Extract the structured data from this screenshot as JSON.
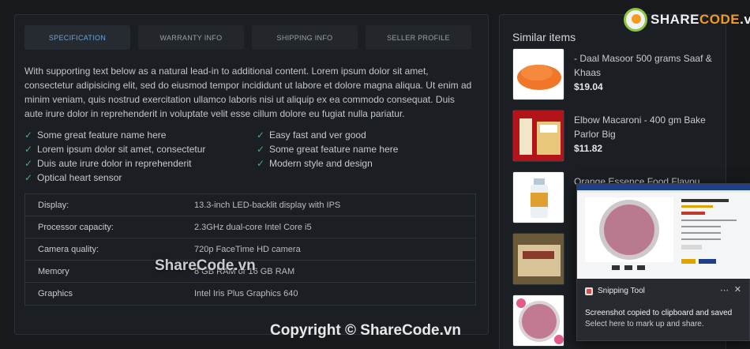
{
  "tabs": [
    {
      "label": "SPECIFICATION",
      "active": true
    },
    {
      "label": "WARRANTY INFO"
    },
    {
      "label": "SHIPPING INFO"
    },
    {
      "label": "SELLER PROFILE"
    }
  ],
  "description": "With supporting text below as a natural lead-in to additional content. Lorem ipsum dolor sit amet, consectetur adipisicing elit, sed do eiusmod tempor incididunt ut labore et dolore magna aliqua. Ut enim ad minim veniam, quis nostrud exercitation ullamco laboris nisi ut aliquip ex ea commodo consequat. Duis aute irure dolor in reprehenderit in voluptate velit esse cillum dolore eu fugiat nulla pariatur.",
  "features": [
    "Some great feature name here",
    "Easy fast and ver good",
    "Lorem ipsum dolor sit amet, consectetur",
    "Some great feature name here",
    "Duis aute irure dolor in reprehenderit",
    "Modern style and design",
    "Optical heart sensor"
  ],
  "specs": [
    {
      "key": "Display:",
      "value": "13.3-inch LED-backlit display with IPS"
    },
    {
      "key": "Processor capacity:",
      "value": "2.3GHz dual-core Intel Core i5"
    },
    {
      "key": "Camera quality:",
      "value": "720p FaceTime HD camera"
    },
    {
      "key": "Memory",
      "value": "8 GB RAM or 16 GB RAM"
    },
    {
      "key": "Graphics",
      "value": "Intel Iris Plus Graphics 640"
    }
  ],
  "similar": {
    "title": "Similar items",
    "items": [
      {
        "name": "- Daal Masoor 500 grams Saaf & Khaas",
        "price": "$19.04",
        "thumb": "lentils"
      },
      {
        "name": "Elbow Macaroni - 400 gm Bake Parlor Big",
        "price": "$11.82",
        "thumb": "macaroni"
      },
      {
        "name": "Orange Essence Food Flavou",
        "price": "",
        "thumb": "bottle"
      },
      {
        "name": "",
        "price": "",
        "thumb": "package"
      },
      {
        "name": "",
        "price": "",
        "thumb": "powder"
      }
    ]
  },
  "logo": {
    "text_main": "SHARE",
    "text_accent": "CODE",
    "text_tail": ".vn"
  },
  "toast": {
    "app_name": "Snipping Tool",
    "message": "Screenshot copied to clipboard and saved",
    "sub": "Select here to mark up and share."
  },
  "watermark": "ShareCode.vn",
  "copyright": "Copyright © ShareCode.vn",
  "colors": {
    "accent": "#6ea3d9",
    "check": "#4caf6a",
    "logo_orange": "#f29b1d",
    "logo_green": "#8cc63e"
  }
}
